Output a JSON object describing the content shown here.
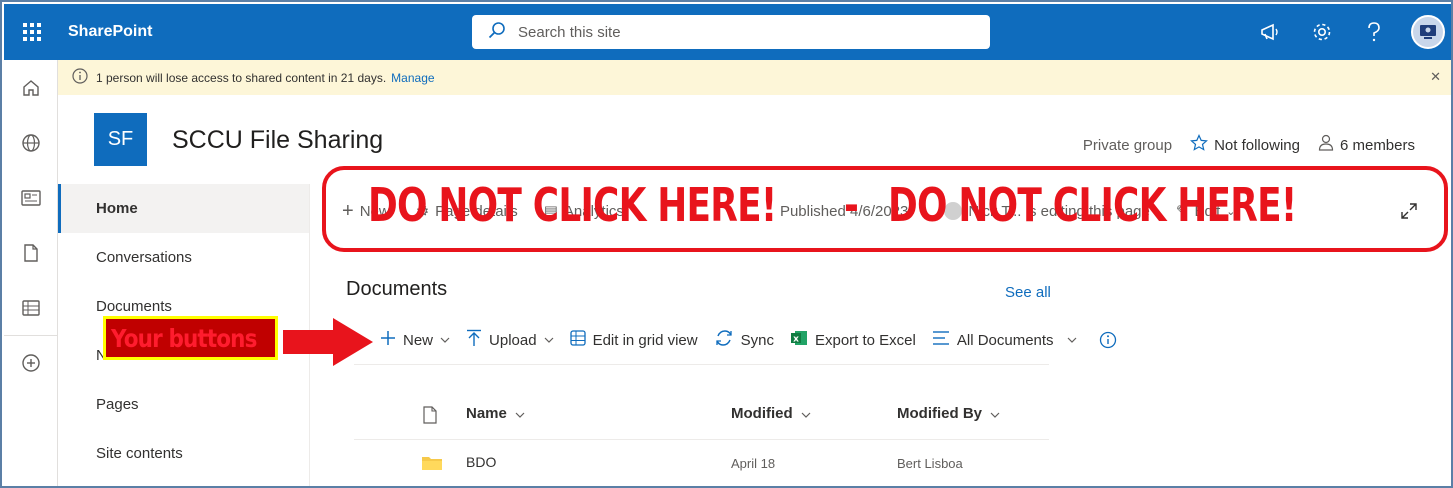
{
  "suite": {
    "app_name": "SharePoint",
    "search_placeholder": "Search this site",
    "icons": [
      "app-launcher-icon",
      "megaphone-icon",
      "gear-icon",
      "help-icon",
      "avatar"
    ]
  },
  "appbar": {
    "icons": [
      "home-icon",
      "globe-icon",
      "news-icon",
      "file-icon",
      "list-icon",
      "add-circle-icon"
    ]
  },
  "notice": {
    "text": "1 person will lose access to shared content in 21 days.",
    "link": "Manage"
  },
  "site": {
    "logo_initials": "SF",
    "title": "SCCU File Sharing",
    "privacy": "Private group",
    "follow": "Not following",
    "members": "6 members"
  },
  "nav": {
    "items": [
      {
        "label": "Home",
        "active": true
      },
      {
        "label": "Conversations"
      },
      {
        "label": "Documents"
      },
      {
        "label": "N"
      },
      {
        "label": "Pages"
      },
      {
        "label": "Site contents"
      }
    ]
  },
  "command_bar": {
    "new": "New",
    "page_details": "Page details",
    "analytics": "Analytics",
    "published": "Published 4/6/2023",
    "editing": "Nick T... is editing this page",
    "edit": "Edit"
  },
  "annotations": {
    "warning_1": "DO NOT CLICK HERE!",
    "dash": "-",
    "warning_2": "DO NOT CLICK HERE!",
    "your_buttons": "Your buttons",
    "accent_red": "#e8141c",
    "highlight_yellow": "#ffff00"
  },
  "documents": {
    "title": "Documents",
    "see_all": "See all",
    "toolbar": {
      "new": "New",
      "upload": "Upload",
      "grid": "Edit in grid view",
      "sync": "Sync",
      "export": "Export to Excel",
      "view": "All Documents"
    },
    "columns": {
      "name": "Name",
      "modified": "Modified",
      "modified_by": "Modified By"
    },
    "rows": [
      {
        "name": "BDO",
        "modified": "April 18",
        "modified_by": "Bert Lisboa"
      }
    ]
  },
  "colors": {
    "brand": "#0f6cbd",
    "notice_bg": "#fdf6d8"
  }
}
